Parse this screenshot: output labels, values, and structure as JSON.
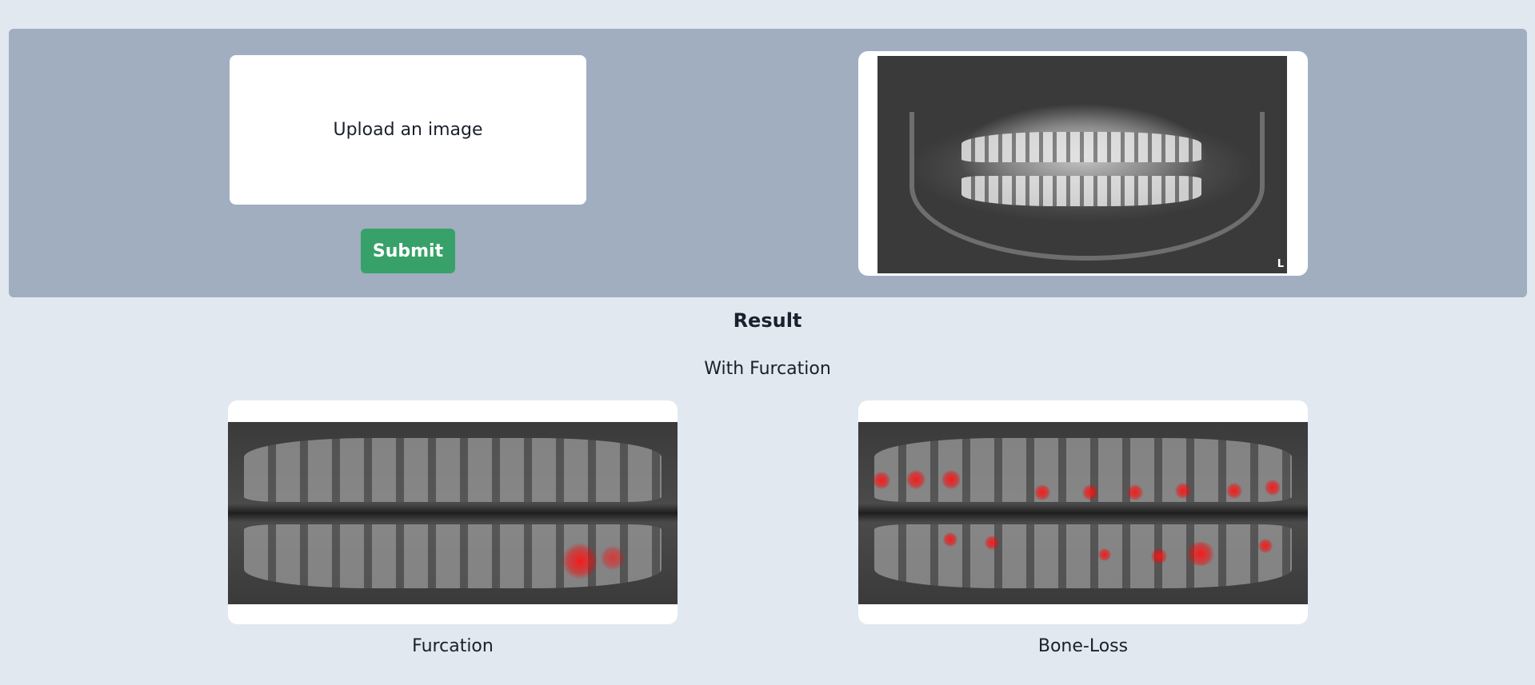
{
  "upload": {
    "label": "Upload an image"
  },
  "submit": {
    "label": "Submit"
  },
  "preview": {
    "marker": "L"
  },
  "result": {
    "title": "Result",
    "subtitle": "With Furcation",
    "images": [
      {
        "caption": "Furcation"
      },
      {
        "caption": "Bone-Loss"
      }
    ]
  },
  "colors": {
    "page_bg": "#e2e8f0",
    "panel_bg": "#a0aec0",
    "button_bg": "#38a169",
    "highlight": "#ff1414"
  }
}
